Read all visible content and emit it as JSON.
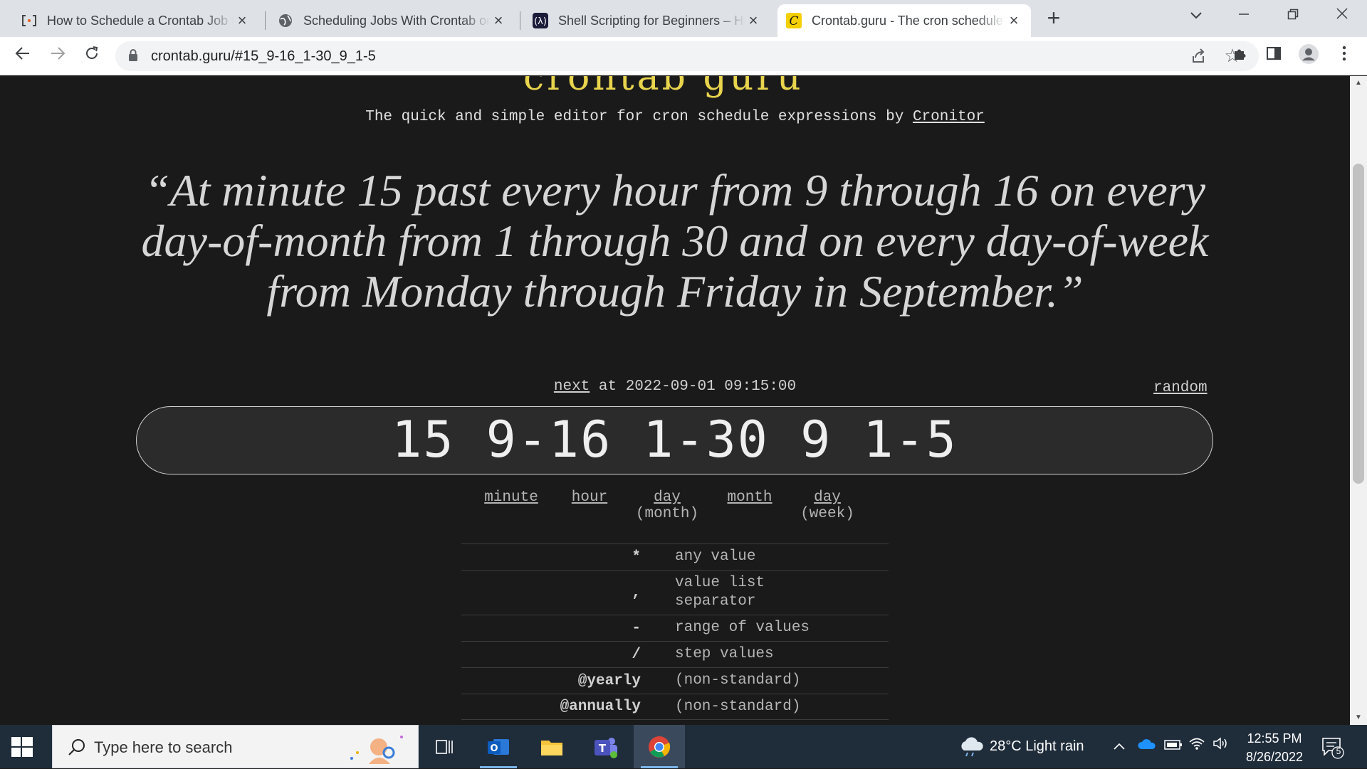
{
  "browser": {
    "tabs": [
      {
        "favicon": "crontab-bracket-icon",
        "title": "How to Schedule a Crontab Job f"
      },
      {
        "favicon": "globe-icon",
        "title": "Scheduling Jobs With Crontab on"
      },
      {
        "favicon": "lambda-icon",
        "title": "Shell Scripting for Beginners – Ho"
      },
      {
        "favicon": "crontab-guru-icon",
        "title": "Crontab.guru - The cron schedule"
      }
    ],
    "new_tab_label": "+",
    "url": "crontab.guru/#15_9-16_1-30_9_1-5"
  },
  "page": {
    "tagline_prefix": "The quick and simple editor for cron schedule expressions by ",
    "tagline_link": "Cronitor",
    "human_readable": "“At minute 15 past every hour from 9 through 16 on every day-of-month from 1 through 30 and on every day-of-week from Monday through Friday in September.”",
    "next_label": "next",
    "next_text": " at 2022-09-01 09:15:00",
    "random_label": "random",
    "cron_expression": "15 9-16 1-30 9 1-5",
    "parts": [
      {
        "label": "minute",
        "sub": ""
      },
      {
        "label": "hour",
        "sub": ""
      },
      {
        "label": "day",
        "sub": "(month)"
      },
      {
        "label": "month",
        "sub": ""
      },
      {
        "label": "day",
        "sub": "(week)"
      }
    ],
    "legend": [
      {
        "symbol": "*",
        "desc": "any value"
      },
      {
        "symbol": ",",
        "desc": "value list separator"
      },
      {
        "symbol": "-",
        "desc": "range of values"
      },
      {
        "symbol": "/",
        "desc": "step values"
      },
      {
        "symbol": "@yearly",
        "desc": "(non-standard)"
      },
      {
        "symbol": "@annually",
        "desc": "(non-standard)"
      }
    ]
  },
  "taskbar": {
    "search_placeholder": "Type here to search",
    "weather": "28°C  Light rain",
    "time": "12:55 PM",
    "date": "8/26/2022",
    "notification_count": "5"
  },
  "colors": {
    "page_bg": "#1a1a1a",
    "logo_yellow": "#e8d44d",
    "taskbar_bg": "#1f2c3a"
  }
}
